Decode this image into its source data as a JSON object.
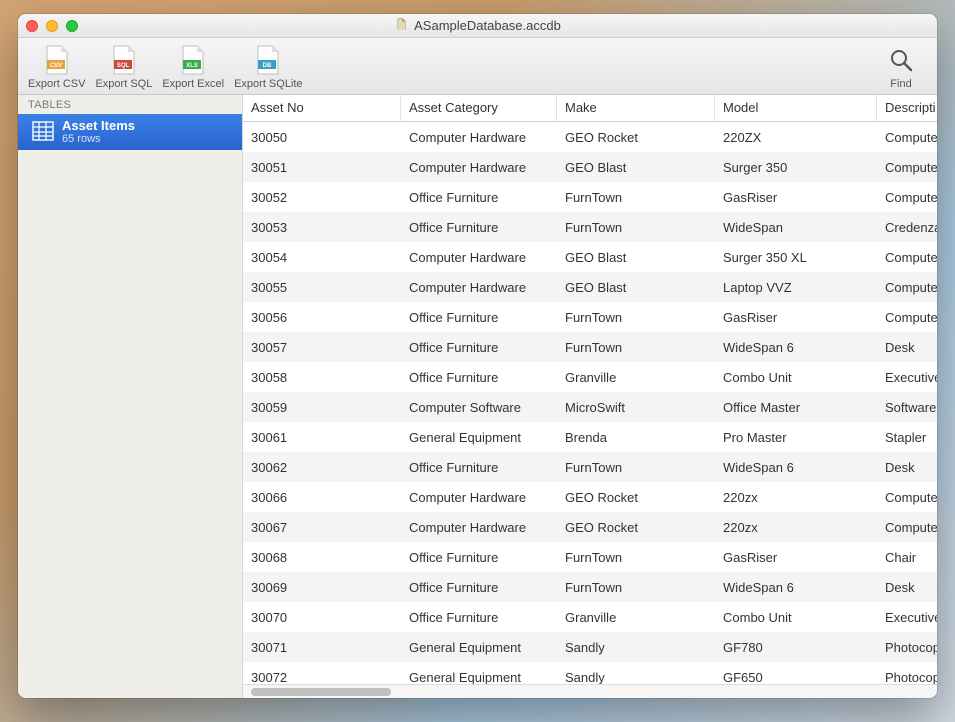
{
  "window": {
    "title": "ASampleDatabase.accdb"
  },
  "toolbar": {
    "export_csv": "Export CSV",
    "export_sql": "Export SQL",
    "export_excel": "Export Excel",
    "export_sqlite": "Export SQLite",
    "find": "Find"
  },
  "sidebar": {
    "header": "TABLES",
    "items": [
      {
        "name": "Asset Items",
        "rows_label": "65 rows",
        "selected": true
      }
    ]
  },
  "table": {
    "columns": [
      "Asset No",
      "Asset Category",
      "Make",
      "Model",
      "Descripti"
    ],
    "rows": [
      {
        "no": "30050",
        "cat": "Computer Hardware",
        "make": "GEO Rocket",
        "model": "220ZX",
        "desc": "Compute"
      },
      {
        "no": "30051",
        "cat": "Computer Hardware",
        "make": "GEO Blast",
        "model": "Surger 350",
        "desc": "Compute"
      },
      {
        "no": "30052",
        "cat": "Office Furniture",
        "make": "FurnTown",
        "model": "GasRiser",
        "desc": "Compute"
      },
      {
        "no": "30053",
        "cat": "Office Furniture",
        "make": "FurnTown",
        "model": "WideSpan",
        "desc": "Credenza"
      },
      {
        "no": "30054",
        "cat": "Computer Hardware",
        "make": "GEO Blast",
        "model": "Surger 350 XL",
        "desc": "Compute"
      },
      {
        "no": "30055",
        "cat": "Computer Hardware",
        "make": "GEO Blast",
        "model": "Laptop VVZ",
        "desc": "Compute"
      },
      {
        "no": "30056",
        "cat": "Office Furniture",
        "make": "FurnTown",
        "model": "GasRiser",
        "desc": "Compute"
      },
      {
        "no": "30057",
        "cat": "Office Furniture",
        "make": "FurnTown",
        "model": "WideSpan 6",
        "desc": "Desk"
      },
      {
        "no": "30058",
        "cat": "Office Furniture",
        "make": "Granville",
        "model": "Combo Unit",
        "desc": "Executive"
      },
      {
        "no": "30059",
        "cat": "Computer Software",
        "make": "MicroSwift",
        "model": "Office Master",
        "desc": "Software"
      },
      {
        "no": "30061",
        "cat": "General Equipment",
        "make": "Brenda",
        "model": "Pro Master",
        "desc": "Stapler"
      },
      {
        "no": "30062",
        "cat": "Office Furniture",
        "make": "FurnTown",
        "model": "WideSpan 6",
        "desc": "Desk"
      },
      {
        "no": "30066",
        "cat": "Computer Hardware",
        "make": "GEO Rocket",
        "model": "220zx",
        "desc": "Compute"
      },
      {
        "no": "30067",
        "cat": "Computer Hardware",
        "make": "GEO Rocket",
        "model": "220zx",
        "desc": "Compute"
      },
      {
        "no": "30068",
        "cat": "Office Furniture",
        "make": "FurnTown",
        "model": "GasRiser",
        "desc": "Chair"
      },
      {
        "no": "30069",
        "cat": "Office Furniture",
        "make": "FurnTown",
        "model": "WideSpan 6",
        "desc": "Desk"
      },
      {
        "no": "30070",
        "cat": "Office Furniture",
        "make": "Granville",
        "model": "Combo Unit",
        "desc": "Executive"
      },
      {
        "no": "30071",
        "cat": "General Equipment",
        "make": "Sandly",
        "model": "GF780",
        "desc": "Photocop"
      },
      {
        "no": "30072",
        "cat": "General Equipment",
        "make": "Sandly",
        "model": "GF650",
        "desc": "Photocop"
      }
    ]
  },
  "icons": {
    "csv_tag": "CSV",
    "sql_tag": "SQL",
    "xls_tag": "XLS",
    "db_tag": "DB"
  }
}
